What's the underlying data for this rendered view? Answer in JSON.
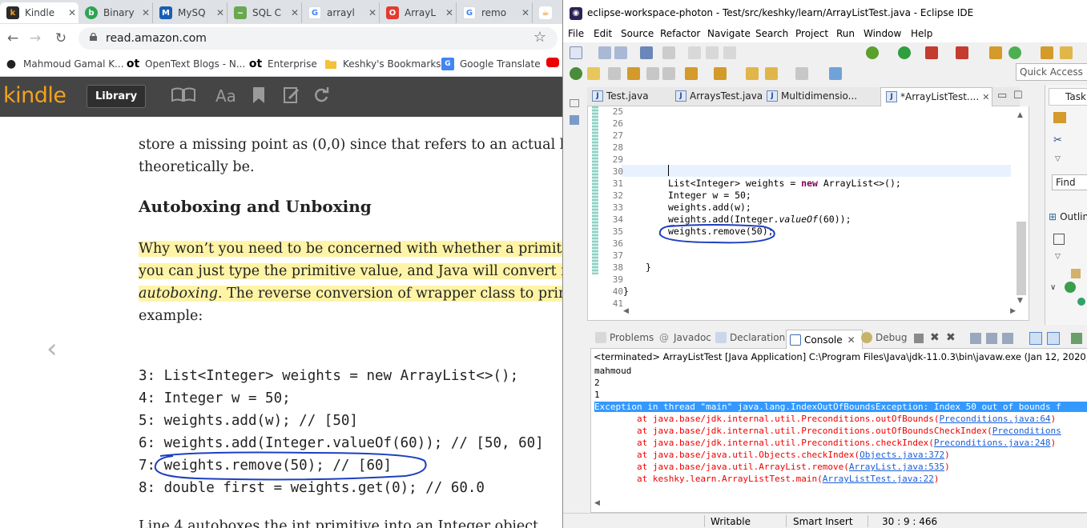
{
  "browser": {
    "tabs": [
      {
        "title": "Kindle",
        "icon": "kindle-icon",
        "color": "#f5a21b"
      },
      {
        "title": "Binary",
        "icon": "binary-icon",
        "color": "#2ea44f"
      },
      {
        "title": "MySQ",
        "icon": "mysql-icon",
        "color": "#1a5db2"
      },
      {
        "title": "SQL C",
        "icon": "sql-icon",
        "color": "#6aa84f"
      },
      {
        "title": "arrayl",
        "icon": "google-icon",
        "color": "#4285f4"
      },
      {
        "title": "ArrayL",
        "icon": "oracle-icon",
        "color": "#e03c31"
      },
      {
        "title": "remo",
        "icon": "google-icon",
        "color": "#4285f4"
      },
      {
        "title": "",
        "icon": "java-icon",
        "color": "#e76f00"
      }
    ],
    "url": "read.amazon.com",
    "bookmarks": [
      {
        "label": "Mahmoud Gamal K...",
        "icon": "github-icon"
      },
      {
        "label": "OpenText Blogs - N...",
        "icon": "opentext-icon"
      },
      {
        "label": "Enterprise",
        "icon": "opentext-icon"
      },
      {
        "label": "Keshky's Bookmarks",
        "icon": "folder-icon"
      },
      {
        "label": "Google Translate",
        "icon": "translate-icon"
      }
    ]
  },
  "kindle": {
    "logo": "kindle",
    "library_label": "Library",
    "font_button": "Aa"
  },
  "book": {
    "para1_line1": "store a missing point as (0,0) since that refers to an actual lo",
    "para1_line2": "theoretically be.",
    "heading": "Autoboxing and Unboxing",
    "para2_line1": "Why won’t you need to be concerned with whether a primiti",
    "para2_line2": "you can just type the primitive value, and Java will convert i",
    "para2_line3_em": "autoboxing",
    "para2_line3_rest": ". The reverse conversion of wrapper class to prim",
    "para2_line4": "example:",
    "code_lines": [
      "3: List<Integer> weights = new ArrayList<>();",
      "4: Integer w = 50;",
      "5: weights.add(w); // [50]",
      "6: weights.add(Integer.valueOf(60)); // [50, 60]",
      "7: weights.remove(50); // [60]",
      "8: double first = weights.get(0); // 60.0"
    ],
    "cut_line": "Line 4 autoboxes the int primitive into an Integer object"
  },
  "eclipse": {
    "title": "eclipse-workspace-photon - Test/src/keshky/learn/ArrayListTest.java - Eclipse IDE",
    "menu": [
      "File",
      "Edit",
      "Source",
      "Refactor",
      "Navigate",
      "Search",
      "Project",
      "Run",
      "Window",
      "Help"
    ],
    "quick_access": "Quick Access",
    "editor_tabs": [
      "Test.java",
      "ArraysTest.java",
      "Multidimensio...",
      "*ArrayListTest...."
    ],
    "right_tabs": {
      "task": "Task L",
      "find": "Find",
      "outline": "Outlin"
    },
    "line_numbers": [
      "25",
      "26",
      "27",
      "28",
      "29",
      "30",
      "31",
      "32",
      "33",
      "34",
      "35",
      "36",
      "37",
      "38",
      "39",
      "40",
      "41"
    ],
    "code": {
      "l31_type": "List<Integer> weights = ",
      "l31_kw": "new",
      "l31_rest": " ArrayList<>();",
      "l32": "Integer w = 50;",
      "l33": "weights.add(w);",
      "l34_a": "weights.add(Integer.",
      "l34_it": "valueOf",
      "l34_b": "(60));",
      "l35": "weights.remove(50);",
      "l38": "}",
      "l40": "}"
    },
    "console_tabs": [
      "Problems",
      "Javadoc",
      "Declaration",
      "Console",
      "Debug"
    ],
    "console_header": "<terminated> ArrayListTest [Java Application] C:\\Program Files\\Java\\jdk-11.0.3\\bin\\javaw.exe (Jan 12, 2020, 4:47:29 PM",
    "console_out": [
      "mahmoud",
      "2",
      "1"
    ],
    "exception": "Exception in thread \"main\" java.lang.IndexOutOfBoundsException: Index 50 out of bounds f",
    "stack": [
      {
        "text": "\tat java.base/jdk.internal.util.Preconditions.outOfBounds(",
        "link": "Preconditions.java:64",
        "end": ")"
      },
      {
        "text": "\tat java.base/jdk.internal.util.Preconditions.outOfBoundsCheckIndex(",
        "link": "Preconditions",
        "end": ""
      },
      {
        "text": "\tat java.base/jdk.internal.util.Preconditions.checkIndex(",
        "link": "Preconditions.java:248",
        "end": ")"
      },
      {
        "text": "\tat java.base/java.util.Objects.checkIndex(",
        "link": "Objects.java:372",
        "end": ")"
      },
      {
        "text": "\tat java.base/java.util.ArrayList.remove(",
        "link": "ArrayList.java:535",
        "end": ")"
      },
      {
        "text": "\tat keshky.learn.ArrayListTest.main(",
        "link": "ArrayListTest.java:22",
        "end": ")"
      }
    ],
    "status": {
      "writable": "Writable",
      "insert": "Smart Insert",
      "position": "30 : 9 : 466"
    }
  },
  "colors": {
    "kindle_bar": "#454545",
    "kindle_logo": "#f5a21b",
    "highlight": "#fff4a6",
    "annotation": "#1f3fbf",
    "error": "#e00000",
    "java_keyword": "#7f0055"
  }
}
